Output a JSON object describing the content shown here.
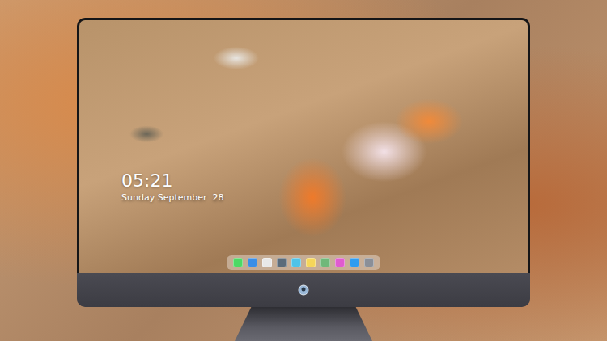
{
  "screen": {
    "clock": {
      "time": "05:21",
      "date": "Sunday September  28"
    }
  },
  "dock": {
    "items": [
      {
        "color": "#4cd964"
      },
      {
        "color": "#3a8ee6"
      },
      {
        "color": "#e8e8e8"
      },
      {
        "color": "#5b6b7a"
      },
      {
        "color": "#4fc3e8"
      },
      {
        "color": "#f5d65a"
      },
      {
        "color": "#6fb87a"
      },
      {
        "color": "#e05bd0"
      },
      {
        "color": "#2f9cf0"
      },
      {
        "color": "#8a8f98"
      }
    ]
  }
}
